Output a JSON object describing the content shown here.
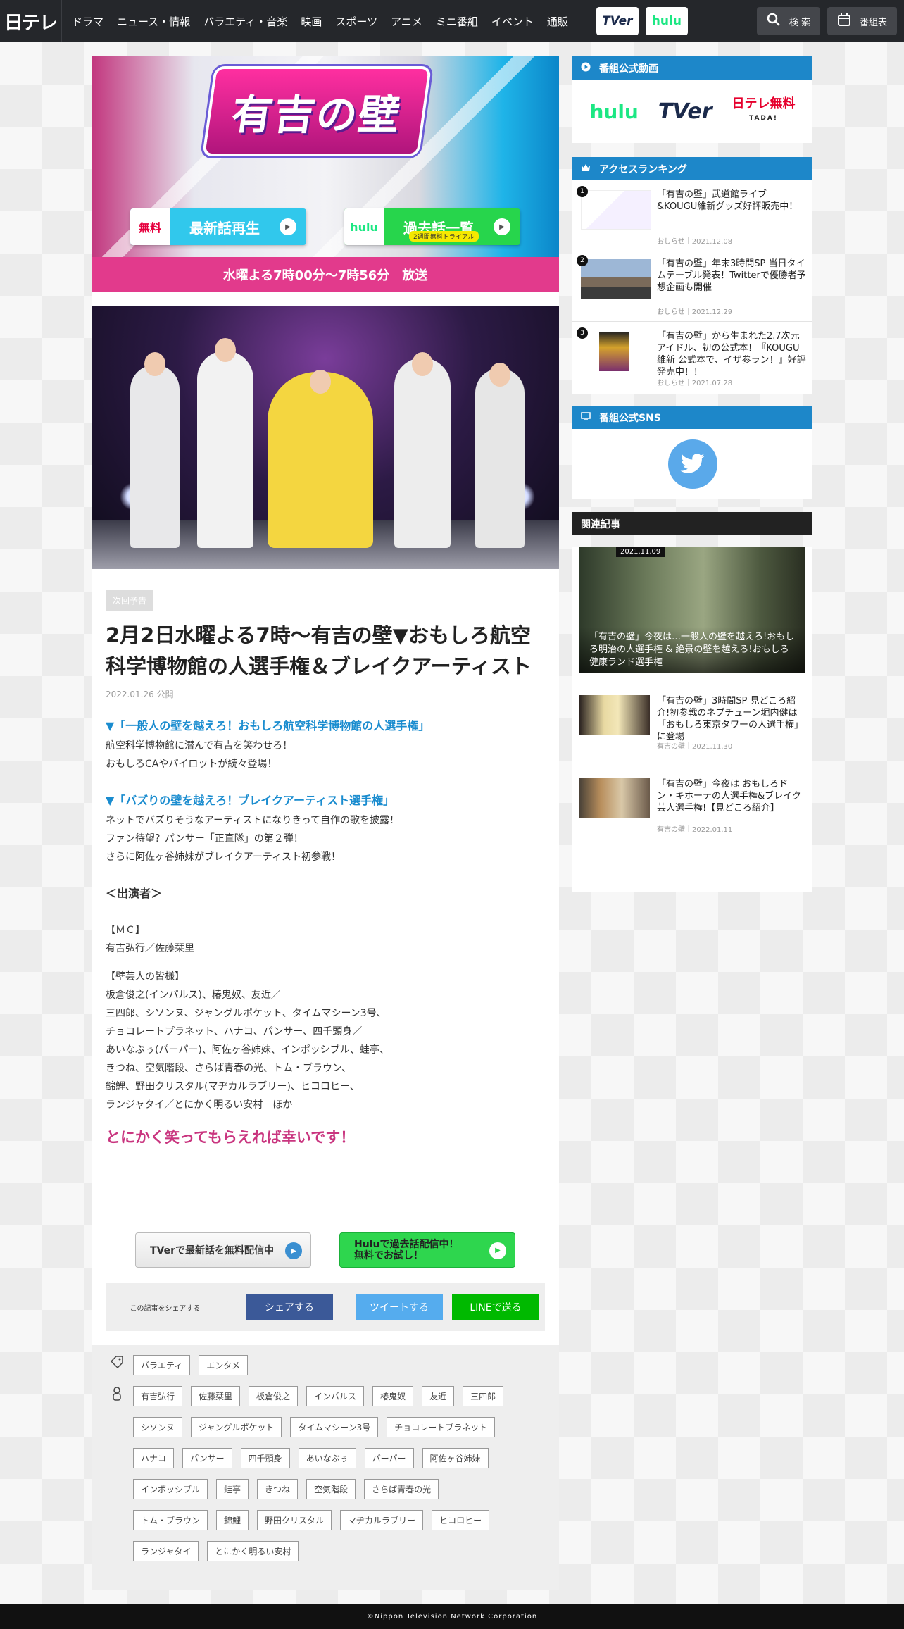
{
  "header": {
    "logo": "日テレ",
    "nav": [
      "ドラマ",
      "ニュース・情報",
      "バラエティ・音楽",
      "映画",
      "スポーツ",
      "アニメ",
      "ミニ番組",
      "イベント",
      "通販"
    ],
    "tver": "TVer",
    "hulu": "hulu",
    "search_label": "検 索",
    "schedule_label": "番組表"
  },
  "hero": {
    "title": "有吉の壁",
    "left_btn_tag": "無料",
    "left_btn_label": "最新話再生",
    "right_btn_tag": "hulu",
    "right_btn_label": "過去話一覧",
    "right_btn_sub": "2週間無料トライアル",
    "airtime": "水曜よる7時00分～7時56分　放送"
  },
  "article": {
    "badge": "次回予告",
    "headline": "2月2日水曜よる7時～有吉の壁▼おもしろ航空科学博物館の人選手権＆ブレイクアーティスト",
    "pubdate": "2022.01.26 公開",
    "sec1_title": "▼「一般人の壁を越えろ！おもしろ航空科学博物館の人選手権」",
    "sec1_lines": [
      "航空科学博物館に潜んで有吉を笑わせろ！",
      "おもしろCAやパイロットが続々登場！"
    ],
    "sec2_title": "▼「バズりの壁を越えろ！ブレイクアーティスト選手権」",
    "sec2_lines": [
      "ネットでバズりそうなアーティストになりきって自作の歌を披露！",
      "ファン待望？パンサー「正直隊」の第２弾！",
      "さらに阿佐ヶ谷姉妹がブレイクアーティスト初参戦！"
    ],
    "cast_header": "＜出演者＞",
    "mc_label": "【ＭＣ】",
    "mc": "有吉弘行／佐藤栞里",
    "geinin_label": "【壁芸人の皆様】",
    "geinin_lines": [
      "板倉俊之(インパルス)、椿鬼奴、友近／",
      "三四郎、シソンヌ、ジャングルポケット、タイムマシーン3号、",
      "チョコレートプラネット、ハナコ、パンサー、四千頭身／",
      "あいなぶぅ(パーパー)、阿佐ヶ谷姉妹、インポッシブル、蛙亭、",
      "きつね、空気階段、さらば青春の光、トム・ブラウン、",
      "錦鯉、野田クリスタル(マヂカルラブリー)、ヒコロヒー、",
      "ランジャタイ／とにかく明るい安村　ほか"
    ],
    "closing": "とにかく笑ってもらえれば幸いです！"
  },
  "cta": {
    "tver": "TVerで最新話を無料配信中",
    "hulu_line1": "Huluで過去話配信中！",
    "hulu_line2": "無料でお試し！"
  },
  "share": {
    "label": "この記事をシェアする",
    "facebook": "シェアする",
    "twitter": "ツイートする",
    "line": "LINEで送る"
  },
  "tags": {
    "genre": [
      "バラエティ",
      "エンタメ"
    ],
    "people_rows": [
      [
        "有吉弘行",
        "佐藤栞里",
        "板倉俊之",
        "インパルス",
        "椿鬼奴",
        "友近",
        "三四郎"
      ],
      [
        "シソンヌ",
        "ジャングルポケット",
        "タイムマシーン3号",
        "チョコレートプラネット"
      ],
      [
        "ハナコ",
        "パンサー",
        "四千頭身",
        "あいなぶぅ",
        "パーパー",
        "阿佐ヶ谷姉妹"
      ],
      [
        "インポッシブル",
        "蛙亭",
        "きつね",
        "空気階段",
        "さらば青春の光"
      ],
      [
        "トム・ブラウン",
        "錦鯉",
        "野田クリスタル",
        "マヂカルラブリー",
        "ヒコロヒー"
      ],
      [
        "ランジャタイ",
        "とにかく明るい安村"
      ]
    ]
  },
  "sidebar": {
    "video_title": "番組公式動画",
    "video_logos": {
      "hulu": "hulu",
      "tver": "TVer",
      "ntv_main": "日テレ無料",
      "ntv_sub": "TADA!"
    },
    "ranking_title": "アクセスランキング",
    "ranking": [
      {
        "num": "1",
        "title": "「有吉の壁」武道館ライブ&KOUGU維新グッズ好評販売中！",
        "meta": "おしらせ｜2021.12.08"
      },
      {
        "num": "2",
        "title": "「有吉の壁」年末3時間SP 当日タイムテーブル発表！Twitterで優勝者予想企画も開催",
        "meta": "おしらせ｜2021.12.29"
      },
      {
        "num": "3",
        "title": "「有吉の壁」から生まれた2.7次元アイドル、初の公式本！『KOUGU維新 公式本で、イザ参ラン！』好評発売中！！",
        "meta": "おしらせ｜2021.07.28"
      }
    ],
    "sns_title": "番組公式SNS",
    "related_title": "関連記事",
    "related_big": {
      "date": "2021.11.09",
      "caption": "「有吉の壁」今夜は…一般人の壁を越えろ!おもしろ明治の人選手権 & 絶景の壁を越えろ!おもしろ健康ランド選手権"
    },
    "related": [
      {
        "title": "「有吉の壁」3時間SP 見どころ紹介!初参戦のネプチューン堀内健は「おもしろ東京タワーの人選手権」に登場",
        "meta": "有吉の壁｜2021.11.30"
      },
      {
        "title": "「有吉の壁」今夜は おもしろドン・キホーテの人選手権&ブレイク芸人選手権!【見どころ紹介】",
        "meta": "有吉の壁｜2022.01.11"
      }
    ]
  },
  "footer": "©Nippon Television Network Corporation",
  "colors": {
    "brand_blue": "#1d87c9",
    "pink": "#e23a8c",
    "link_blue": "#1a8ccf",
    "closing_pink": "#c9357f"
  }
}
